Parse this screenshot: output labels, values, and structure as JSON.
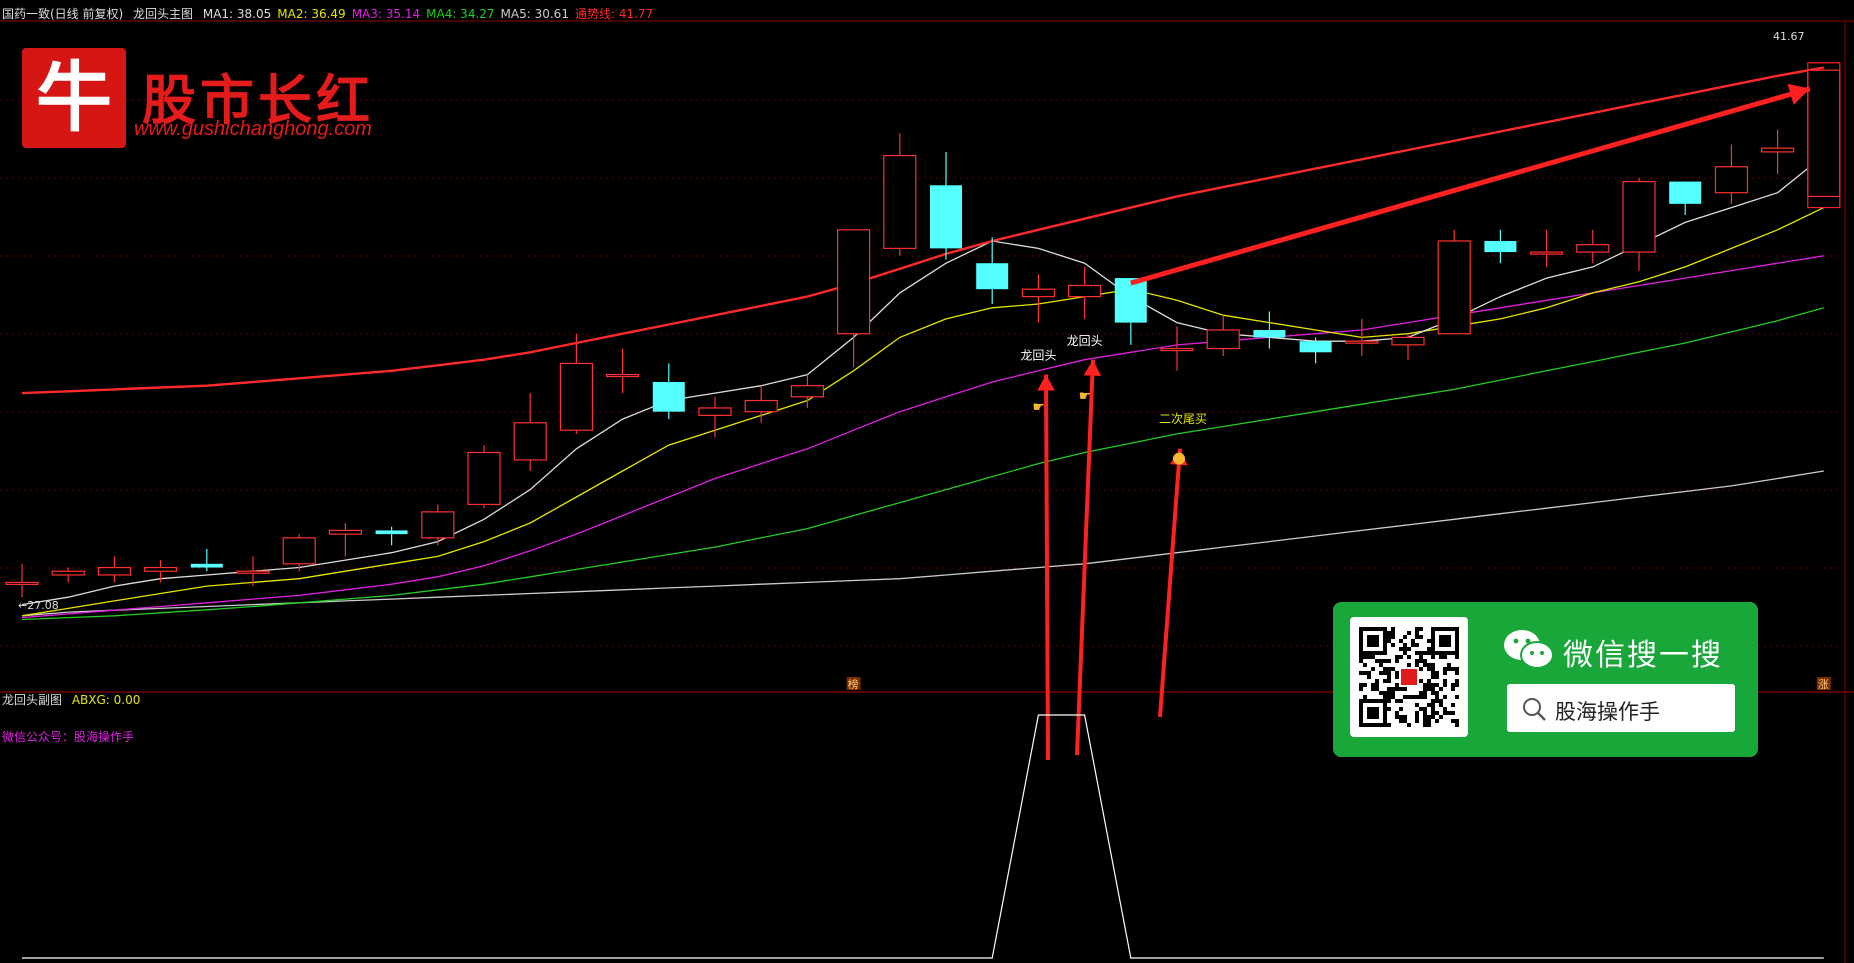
{
  "header": {
    "stock_name": "国药一致(日线 前复权)",
    "indicator_name": "龙回头主图",
    "ma_items": [
      {
        "label": "MA1: 38.05",
        "color": "#dddddd"
      },
      {
        "label": "MA2: 36.49",
        "color": "#e6e600"
      },
      {
        "label": "MA3: 35.14",
        "color": "#e020e0"
      },
      {
        "label": "MA4: 34.27",
        "color": "#22cc22"
      },
      {
        "label": "MA5: 30.61",
        "color": "#cccccc"
      },
      {
        "label": "通势线: 41.77",
        "color": "#ff2a2a"
      }
    ]
  },
  "sub_header": {
    "indicator_name": "龙回头副图",
    "abxg_label": "ABXG: 0.00",
    "wechat_line": "微信公众号：股海操作手"
  },
  "logo": {
    "char": "牛",
    "title": "股市长红",
    "url": "www.gushichanghong.com"
  },
  "wechat_card": {
    "title": "微信搜一搜",
    "search_text": "股海操作手"
  },
  "chart_data": {
    "type": "candlestick",
    "price_range": [
      25.0,
      43.0
    ],
    "high_label": "41.67",
    "low_label": "27.08",
    "colors": {
      "up": "#ff3030",
      "down": "#54ffff",
      "ma1": "#dddddd",
      "ma2": "#e6e600",
      "ma3": "#e020e0",
      "ma4": "#22cc22",
      "ma5": "#cccccc",
      "trend": "#ff2a2a"
    },
    "candles": [
      {
        "o": 27.9,
        "c": 27.9,
        "h": 28.4,
        "l": 27.5
      },
      {
        "o": 28.1,
        "c": 28.2,
        "h": 28.3,
        "l": 27.9
      },
      {
        "o": 28.1,
        "c": 28.3,
        "h": 28.6,
        "l": 27.9
      },
      {
        "o": 28.2,
        "c": 28.3,
        "h": 28.5,
        "l": 27.9
      },
      {
        "o": 28.4,
        "c": 28.3,
        "h": 28.8,
        "l": 28.2
      },
      {
        "o": 28.2,
        "c": 28.2,
        "h": 28.6,
        "l": 27.8
      },
      {
        "o": 28.4,
        "c": 29.1,
        "h": 29.2,
        "l": 28.2
      },
      {
        "o": 29.2,
        "c": 29.3,
        "h": 29.5,
        "l": 28.6
      },
      {
        "o": 29.3,
        "c": 29.2,
        "h": 29.4,
        "l": 28.9
      },
      {
        "o": 29.1,
        "c": 29.8,
        "h": 30.0,
        "l": 28.9
      },
      {
        "o": 30.0,
        "c": 31.4,
        "h": 31.6,
        "l": 29.9
      },
      {
        "o": 31.2,
        "c": 32.2,
        "h": 33.0,
        "l": 30.9
      },
      {
        "o": 32.0,
        "c": 33.8,
        "h": 34.6,
        "l": 31.9
      },
      {
        "o": 33.5,
        "c": 33.5,
        "h": 34.2,
        "l": 33.0
      },
      {
        "o": 33.3,
        "c": 32.5,
        "h": 33.8,
        "l": 32.3
      },
      {
        "o": 32.4,
        "c": 32.6,
        "h": 32.9,
        "l": 31.8
      },
      {
        "o": 32.5,
        "c": 32.8,
        "h": 33.2,
        "l": 32.2
      },
      {
        "o": 32.9,
        "c": 33.2,
        "h": 33.5,
        "l": 32.6
      },
      {
        "o": 34.6,
        "c": 37.4,
        "h": 37.4,
        "l": 33.7
      },
      {
        "o": 36.9,
        "c": 39.4,
        "h": 40.0,
        "l": 36.7
      },
      {
        "o": 38.6,
        "c": 36.9,
        "h": 39.5,
        "l": 36.6
      },
      {
        "o": 36.5,
        "c": 35.8,
        "h": 37.2,
        "l": 35.4
      },
      {
        "o": 35.6,
        "c": 35.8,
        "h": 36.2,
        "l": 34.9
      },
      {
        "o": 35.6,
        "c": 35.9,
        "h": 36.4,
        "l": 35.0
      },
      {
        "o": 36.1,
        "c": 34.9,
        "h": 36.1,
        "l": 34.3
      },
      {
        "o": 34.2,
        "c": 34.2,
        "h": 34.8,
        "l": 33.6
      },
      {
        "o": 34.2,
        "c": 34.7,
        "h": 35.1,
        "l": 34.0
      },
      {
        "o": 34.7,
        "c": 34.5,
        "h": 35.2,
        "l": 34.2
      },
      {
        "o": 34.4,
        "c": 34.1,
        "h": 34.5,
        "l": 33.8
      },
      {
        "o": 34.4,
        "c": 34.4,
        "h": 35.0,
        "l": 34.0
      },
      {
        "o": 34.3,
        "c": 34.5,
        "h": 34.6,
        "l": 33.9
      },
      {
        "o": 34.6,
        "c": 37.1,
        "h": 37.4,
        "l": 34.6
      },
      {
        "o": 37.1,
        "c": 36.8,
        "h": 37.4,
        "l": 36.5
      },
      {
        "o": 36.8,
        "c": 36.8,
        "h": 37.4,
        "l": 36.4
      },
      {
        "o": 36.8,
        "c": 37.0,
        "h": 37.4,
        "l": 36.5
      },
      {
        "o": 36.8,
        "c": 38.7,
        "h": 38.8,
        "l": 36.3
      },
      {
        "o": 38.7,
        "c": 38.1,
        "h": 38.7,
        "l": 37.8
      },
      {
        "o": 38.4,
        "c": 39.1,
        "h": 39.7,
        "l": 38.1
      },
      {
        "o": 39.5,
        "c": 39.6,
        "h": 40.1,
        "l": 38.9
      },
      {
        "o": 38.3,
        "c": 41.7,
        "h": 41.7,
        "l": 38.3
      }
    ],
    "ma1": [
      27.3,
      27.5,
      27.8,
      28.0,
      28.1,
      28.2,
      28.3,
      28.5,
      28.7,
      29.0,
      29.6,
      30.4,
      31.5,
      32.3,
      32.8,
      33.0,
      33.2,
      33.5,
      34.5,
      35.7,
      36.5,
      37.1,
      36.9,
      36.5,
      35.6,
      34.9,
      34.6,
      34.5,
      34.4,
      34.4,
      34.5,
      35.0,
      35.6,
      36.1,
      36.4,
      37.0,
      37.6,
      38.0,
      38.4,
      39.4
    ],
    "ma2": [
      27.0,
      27.2,
      27.4,
      27.6,
      27.8,
      27.9,
      28.0,
      28.2,
      28.4,
      28.6,
      29.0,
      29.5,
      30.2,
      30.9,
      31.6,
      32.0,
      32.4,
      32.8,
      33.6,
      34.5,
      35.0,
      35.3,
      35.4,
      35.6,
      35.8,
      35.5,
      35.1,
      34.9,
      34.7,
      34.5,
      34.6,
      34.8,
      35.0,
      35.3,
      35.7,
      36.0,
      36.4,
      36.9,
      37.4,
      38.0
    ],
    "ma3": [
      26.95,
      27.05,
      27.15,
      27.25,
      27.35,
      27.45,
      27.55,
      27.7,
      27.85,
      28.05,
      28.35,
      28.75,
      29.2,
      29.7,
      30.2,
      30.7,
      31.1,
      31.5,
      32.0,
      32.5,
      32.9,
      33.3,
      33.6,
      33.9,
      34.1,
      34.3,
      34.4,
      34.5,
      34.6,
      34.7,
      34.9,
      35.1,
      35.3,
      35.5,
      35.7,
      35.9,
      36.1,
      36.3,
      36.5,
      36.7
    ],
    "ma4": [
      26.9,
      26.95,
      27.0,
      27.08,
      27.16,
      27.25,
      27.35,
      27.45,
      27.55,
      27.7,
      27.85,
      28.05,
      28.25,
      28.45,
      28.65,
      28.85,
      29.1,
      29.35,
      29.7,
      30.05,
      30.4,
      30.75,
      31.1,
      31.4,
      31.65,
      31.9,
      32.1,
      32.3,
      32.5,
      32.7,
      32.9,
      33.1,
      33.35,
      33.6,
      33.85,
      34.1,
      34.35,
      34.65,
      34.95,
      35.3
    ],
    "ma5": [
      27.0,
      27.1,
      27.15,
      27.2,
      27.25,
      27.3,
      27.35,
      27.4,
      27.45,
      27.5,
      27.55,
      27.6,
      27.65,
      27.7,
      27.75,
      27.8,
      27.85,
      27.9,
      27.95,
      28.0,
      28.1,
      28.2,
      28.3,
      28.4,
      28.55,
      28.7,
      28.85,
      29.0,
      29.15,
      29.3,
      29.45,
      29.6,
      29.75,
      29.9,
      30.05,
      30.2,
      30.35,
      30.5,
      30.7,
      30.9
    ],
    "trend": [
      33.0,
      33.05,
      33.1,
      33.15,
      33.2,
      33.3,
      33.4,
      33.5,
      33.6,
      33.75,
      33.9,
      34.1,
      34.35,
      34.6,
      34.85,
      35.1,
      35.35,
      35.6,
      35.95,
      36.35,
      36.75,
      37.1,
      37.4,
      37.7,
      38.0,
      38.3,
      38.55,
      38.8,
      39.05,
      39.3,
      39.55,
      39.8,
      40.05,
      40.3,
      40.55,
      40.8,
      41.05,
      41.3,
      41.55,
      41.77
    ],
    "annotations": [
      {
        "text": "龙回头",
        "index": 22,
        "price": 33.9,
        "color": "#ffffff"
      },
      {
        "text": "龙回头",
        "index": 23,
        "price": 34.3,
        "color": "#ffffff"
      },
      {
        "text": "二次尾买",
        "index": 25,
        "price": 32.2,
        "color": "#e6e600"
      }
    ],
    "bottom_markers": [
      {
        "text": "榜",
        "index": 18
      },
      {
        "text": "涨",
        "index": 39
      }
    ],
    "sub_signal": {
      "values": [
        0,
        0,
        0,
        0,
        0,
        0,
        0,
        0,
        0,
        0,
        0,
        0,
        0,
        0,
        0,
        0,
        0,
        0,
        0,
        0,
        0,
        0,
        1,
        1,
        0,
        0,
        0,
        0,
        0,
        0,
        0,
        0,
        0,
        0,
        0,
        0,
        0,
        0,
        0,
        0
      ],
      "range": [
        0,
        1
      ]
    }
  }
}
